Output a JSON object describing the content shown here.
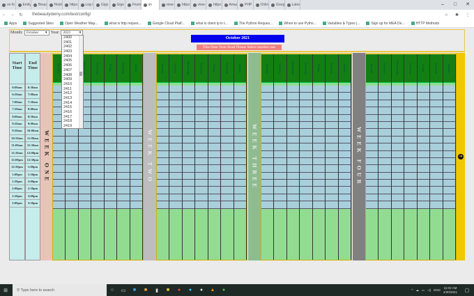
{
  "browser": {
    "tabs": [
      "on fo",
      "Emily",
      "Beaut",
      "Hoshi",
      "https:",
      "Log i",
      "Gigs",
      "Gigs",
      "Fiverr",
      "on",
      "view-",
      "https:",
      "view-",
      "https:",
      "Amaz",
      "PHP",
      "Onlin",
      "Goog",
      "Latest"
    ],
    "url": "thebeautydemy.com/test/config/",
    "bookmarks": [
      "Apps",
      "Suggested Sites",
      "Open Weather Map...",
      "what is http reques...",
      "Google Cloud Platf...",
      "what is client ip in t...",
      "The Python Reques...",
      "When to use Pytho...",
      "Variables & Types |...",
      "Sign up for MEA De...",
      "HTTP Methods"
    ]
  },
  "controls": {
    "month_label": "Month:",
    "month_value": "October",
    "year_label": "Year:",
    "year_value": "2021",
    "year_options": [
      "2400",
      "2401",
      "2402",
      "2403",
      "2404",
      "2405",
      "2406",
      "2407",
      "2408",
      "2409",
      "2410",
      "2411",
      "2412",
      "2413",
      "2414",
      "2415",
      "2416",
      "2417",
      "2418",
      "2419"
    ]
  },
  "calendar": {
    "title": "October 2021",
    "message": "This Date Note Avail Please Select another one",
    "start_header": "Start Time",
    "end_header": "End Time",
    "slots": [
      [
        "6:00am",
        "6:30am"
      ],
      [
        "6:30am",
        "7:00am"
      ],
      [
        "7:00am",
        "7:30am"
      ],
      [
        "7:30am",
        "8:00am"
      ],
      [
        "8:00am",
        "8:30am"
      ],
      [
        "8:30am",
        "9:00am"
      ],
      [
        "9:30am",
        "10:00am"
      ],
      [
        "10:30am",
        "11:00am"
      ],
      [
        "11:00am",
        "11:30am"
      ],
      [
        "11:30am",
        "12:00pm"
      ],
      [
        "12:00pm",
        "12:30pm"
      ],
      [
        "12:30pm",
        "1:00pm"
      ],
      [
        "1:00pm",
        "1:30pm"
      ],
      [
        "1:30pm",
        "2:00pm"
      ],
      [
        "2:00pm",
        "2:30pm"
      ],
      [
        "2:30pm",
        "3:00pm"
      ],
      [
        "3:00pm",
        "3:30pm"
      ]
    ],
    "days": [
      "Monday",
      "Tuesday",
      "Wednesday",
      "Thursday",
      "Friday",
      "Saturday",
      "Sunday"
    ],
    "weeks": [
      {
        "label": "WEEK ONE",
        "color": "#e8c4b8"
      },
      {
        "label": "WEEK TWO",
        "color": "#bdbdbd"
      },
      {
        "label": "WEEK THREE",
        "color": "#8fbc8f"
      },
      {
        "label": "WEEK FOUR",
        "color": "#808080"
      }
    ]
  },
  "taskbar": {
    "search_placeholder": "Type here to search",
    "lang": "ENG",
    "time": "11:02 AM",
    "date": "4/30/2021"
  }
}
